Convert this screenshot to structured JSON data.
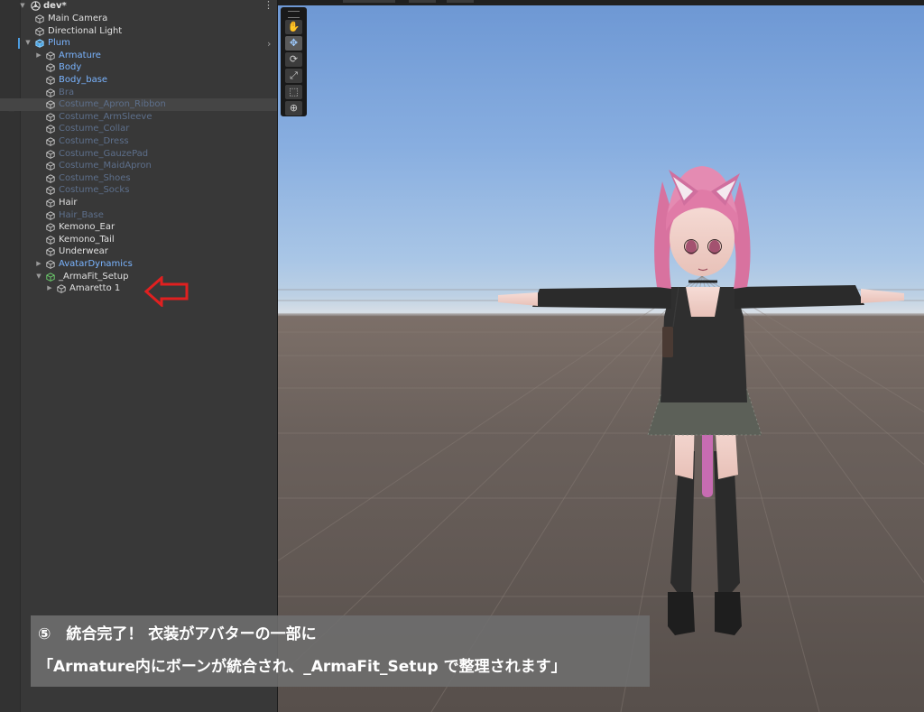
{
  "hierarchy": {
    "scene_name": "dev*",
    "menu_glyph": "⋮",
    "items": [
      {
        "label": "Main Camera",
        "depth": 1,
        "color": "white",
        "foldout": false
      },
      {
        "label": "Directional Light",
        "depth": 1,
        "color": "white",
        "foldout": false
      },
      {
        "label": "Plum",
        "depth": 1,
        "color": "blue",
        "foldout": "open",
        "prefab": true
      },
      {
        "label": "Armature",
        "depth": 2,
        "color": "blue",
        "foldout": "closed"
      },
      {
        "label": "Body",
        "depth": 2,
        "color": "blue",
        "foldout": false
      },
      {
        "label": "Body_base",
        "depth": 2,
        "color": "blue",
        "foldout": false
      },
      {
        "label": "Bra",
        "depth": 2,
        "color": "dim",
        "foldout": false
      },
      {
        "label": "Costume_Apron_Ribbon",
        "depth": 2,
        "color": "dim",
        "foldout": false,
        "hover": true
      },
      {
        "label": "Costume_ArmSleeve",
        "depth": 2,
        "color": "dim",
        "foldout": false
      },
      {
        "label": "Costume_Collar",
        "depth": 2,
        "color": "dim",
        "foldout": false
      },
      {
        "label": "Costume_Dress",
        "depth": 2,
        "color": "dim",
        "foldout": false
      },
      {
        "label": "Costume_GauzePad",
        "depth": 2,
        "color": "dim",
        "foldout": false
      },
      {
        "label": "Costume_MaidApron",
        "depth": 2,
        "color": "dim",
        "foldout": false
      },
      {
        "label": "Costume_Shoes",
        "depth": 2,
        "color": "dim",
        "foldout": false
      },
      {
        "label": "Costume_Socks",
        "depth": 2,
        "color": "dim",
        "foldout": false
      },
      {
        "label": "Hair",
        "depth": 2,
        "color": "white",
        "foldout": false
      },
      {
        "label": "Hair_Base",
        "depth": 2,
        "color": "dim",
        "foldout": false
      },
      {
        "label": "Kemono_Ear",
        "depth": 2,
        "color": "white",
        "foldout": false
      },
      {
        "label": "Kemono_Tail",
        "depth": 2,
        "color": "white",
        "foldout": false
      },
      {
        "label": "Underwear",
        "depth": 2,
        "color": "white",
        "foldout": false
      },
      {
        "label": "AvatarDynamics",
        "depth": 2,
        "color": "blue",
        "foldout": "closed"
      },
      {
        "label": "_ArmaFit_Setup",
        "depth": 2,
        "color": "white",
        "foldout": "open",
        "special": true
      },
      {
        "label": "Amaretto 1",
        "depth": 3,
        "color": "white",
        "foldout": "closed"
      }
    ]
  },
  "toolbar": {
    "tools": [
      {
        "name": "hand-tool",
        "glyph": "✋"
      },
      {
        "name": "move-tool",
        "glyph": "✥",
        "active": true
      },
      {
        "name": "rotate-tool",
        "glyph": "⟳"
      },
      {
        "name": "scale-tool",
        "glyph": "⤢"
      },
      {
        "name": "rect-tool",
        "glyph": "⬚"
      },
      {
        "name": "transform-tool",
        "glyph": "⊕"
      }
    ]
  },
  "caption": {
    "line1": "⑤　統合完了！ 衣装がアバターの一部に",
    "line2": "「Armature内にボーンが統合され、_ArmaFit_Setup で整理されます」"
  },
  "colors": {
    "hierarchy_bg": "#383838",
    "label_white": "#e0e0e0",
    "label_blue": "#7ab4ff",
    "label_dim": "#5d6f8b",
    "arrow_red": "#e02020",
    "caption_bg": "#6e6e6e"
  }
}
